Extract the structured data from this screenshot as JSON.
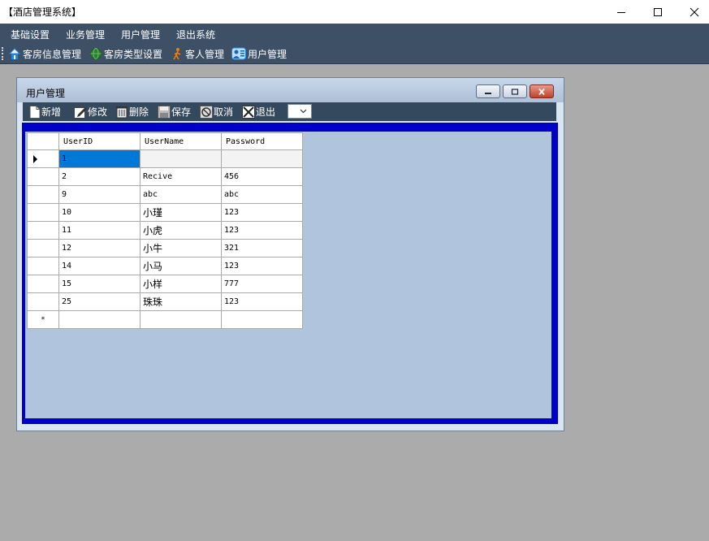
{
  "window": {
    "title": "【酒店管理系统】"
  },
  "menu": [
    "基础设置",
    "业务管理",
    "用户管理",
    "退出系统"
  ],
  "toolbar": {
    "items": [
      {
        "label": "客房信息管理",
        "icon": "house-icon"
      },
      {
        "label": "客房类型设置",
        "icon": "globe-icon"
      },
      {
        "label": "客人管理",
        "icon": "walking-person-icon"
      },
      {
        "label": "用户管理",
        "icon": "users-icon"
      }
    ]
  },
  "form": {
    "title": "用户管理",
    "toolbar": {
      "add": "新增",
      "edit": "修改",
      "delete": "删除",
      "save": "保存",
      "cancel": "取消",
      "exit": "退出"
    }
  },
  "grid": {
    "columns": [
      "UserID",
      "UserName",
      "Password"
    ],
    "rows": [
      {
        "id": "1",
        "name": "",
        "password": ""
      },
      {
        "id": "2",
        "name": "Recive",
        "password": "456"
      },
      {
        "id": "9",
        "name": "abc",
        "password": "abc"
      },
      {
        "id": "10",
        "name": "小瑾",
        "password": "123"
      },
      {
        "id": "11",
        "name": "小虎",
        "password": "123"
      },
      {
        "id": "12",
        "name": "小牛",
        "password": "321"
      },
      {
        "id": "14",
        "name": "小马",
        "password": "123"
      },
      {
        "id": "15",
        "name": "小样",
        "password": "777"
      },
      {
        "id": "25",
        "name": "珠珠",
        "password": "123"
      }
    ],
    "new_row_marker": "*"
  },
  "colors": {
    "menubar": "#3d5066",
    "frame": "#0000c8",
    "client": "#b0c4de",
    "selection": "#0078d7"
  }
}
